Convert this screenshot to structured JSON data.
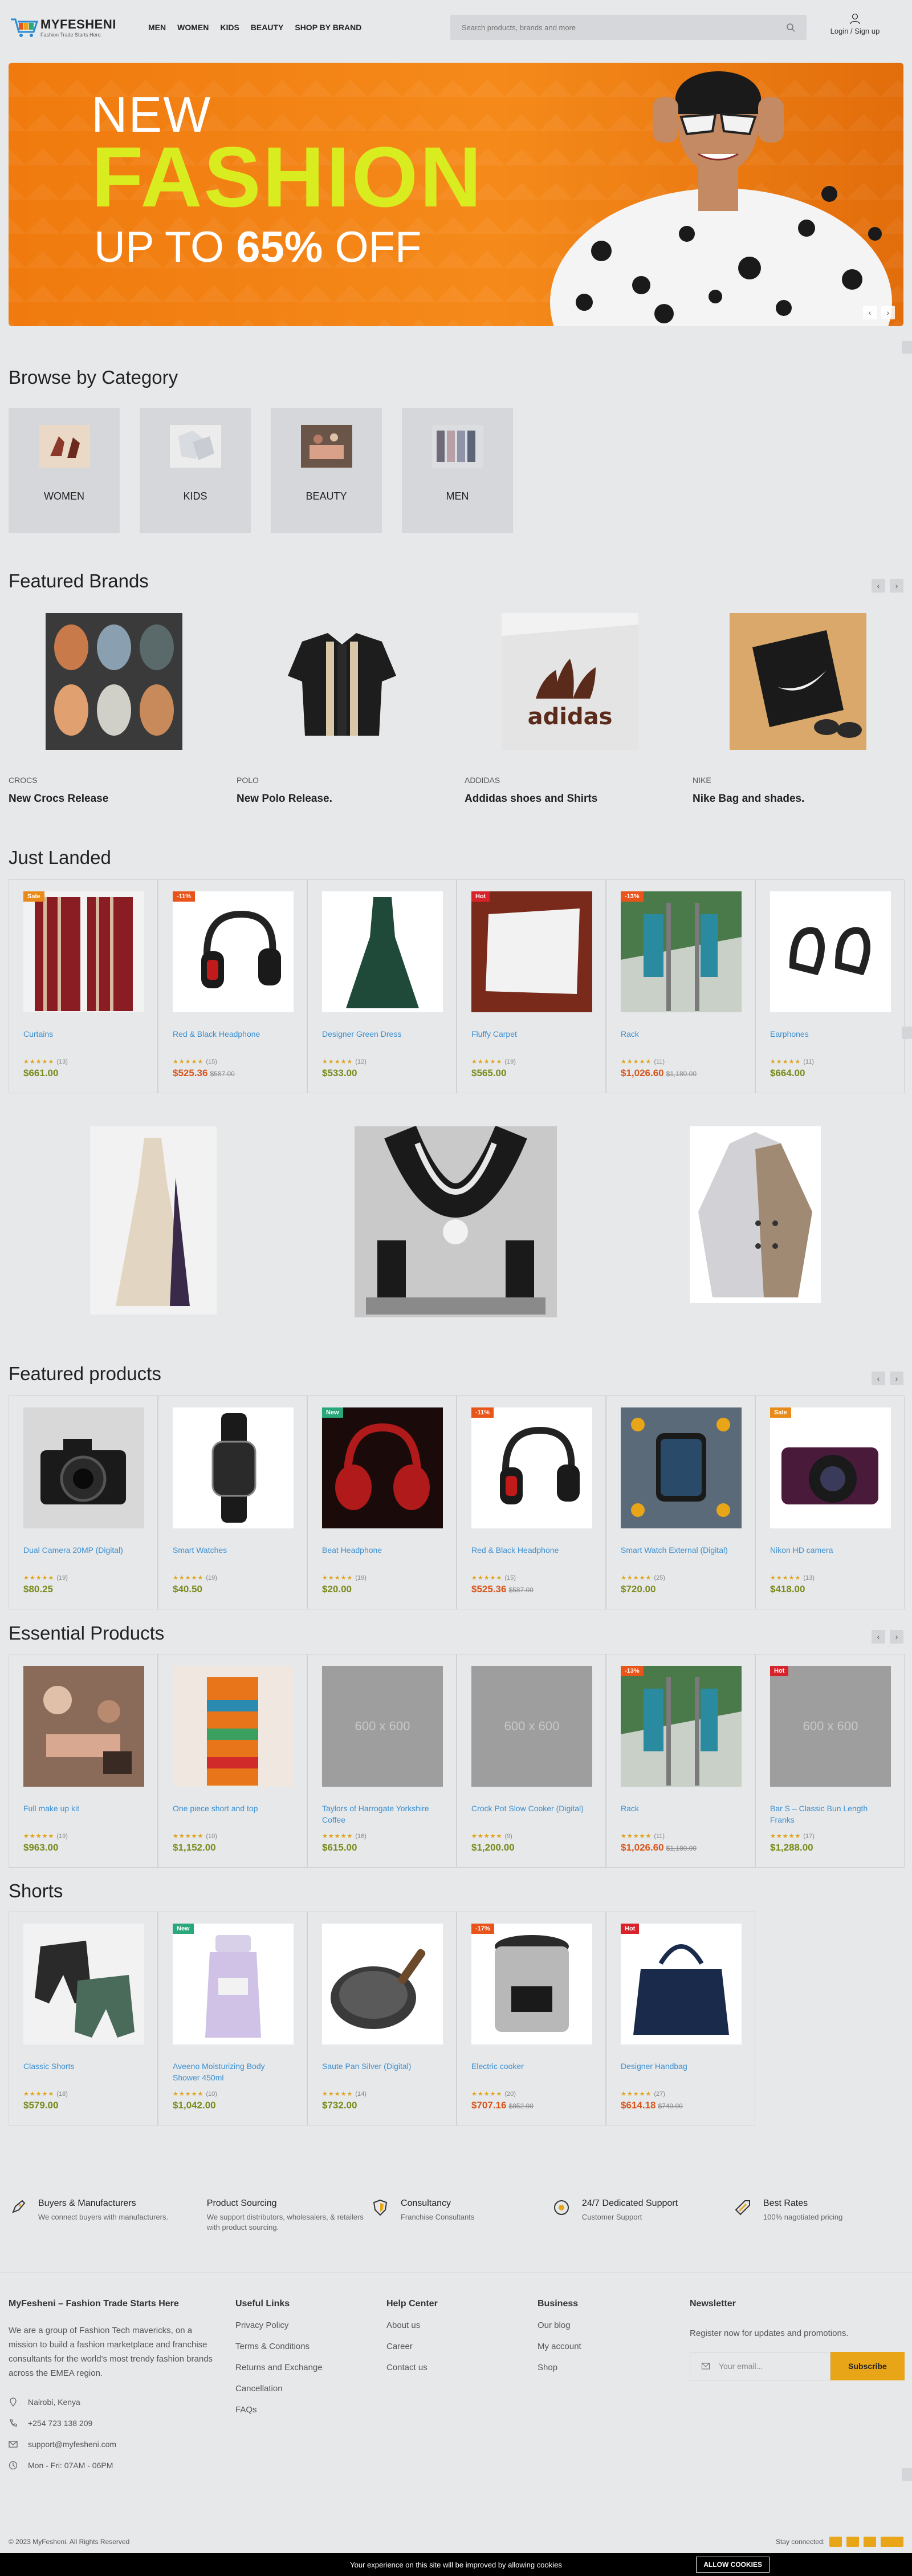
{
  "header": {
    "logo_name": "MYFESHENI",
    "logo_tagline": "Fashion Trade Starts Here.",
    "nav": [
      "MEN",
      "WOMEN",
      "KIDS",
      "BEAUTY",
      "SHOP BY BRAND"
    ],
    "search_placeholder": "Search products, brands and more",
    "account_label": "Login / Sign up"
  },
  "hero": {
    "line1": "NEW",
    "line2": "FASHION",
    "line3_prefix": "UP TO ",
    "line3_bold": "65%",
    "line3_suffix": " OFF",
    "colors": {
      "orange": "#f07a0e",
      "lime": "#d8ec1f"
    }
  },
  "categories": {
    "title": "Browse by Category",
    "items": [
      "WOMEN",
      "KIDS",
      "BEAUTY",
      "MEN"
    ]
  },
  "brands": {
    "title": "Featured Brands",
    "items": [
      {
        "brand": "CROCS",
        "title": "New Crocs Release"
      },
      {
        "brand": "POLO",
        "title": "New Polo Release."
      },
      {
        "brand": "ADDIDAS",
        "title": "Addidas shoes and Shirts"
      },
      {
        "brand": "NIKE",
        "title": "Nike Bag and shades."
      }
    ]
  },
  "just_landed": {
    "title": "Just Landed",
    "products": [
      {
        "name": "Curtains",
        "badge": "Sale",
        "rating_count": "(13)",
        "price": "$661.00",
        "old_price": ""
      },
      {
        "name": "Red & Black Headphone",
        "badge": "-11%",
        "rating_count": "(15)",
        "price": "$525.36",
        "old_price": "$587.00"
      },
      {
        "name": "Designer Green Dress",
        "badge": "",
        "rating_count": "(12)",
        "price": "$533.00",
        "old_price": ""
      },
      {
        "name": "Fluffy Carpet",
        "badge": "Hot",
        "rating_count": "(19)",
        "price": "$565.00",
        "old_price": ""
      },
      {
        "name": "Rack",
        "badge": "-13%",
        "rating_count": "(11)",
        "price": "$1,026.60",
        "old_price": "$1,180.00"
      },
      {
        "name": "Earphones",
        "badge": "",
        "rating_count": "(11)",
        "price": "$664.00",
        "old_price": ""
      }
    ]
  },
  "featured_products": {
    "title": "Featured products",
    "products": [
      {
        "name": "Dual Camera 20MP (Digital)",
        "badge": "",
        "rating_count": "(19)",
        "price": "$80.25",
        "old_price": ""
      },
      {
        "name": "Smart Watches",
        "badge": "",
        "rating_count": "(19)",
        "price": "$40.50",
        "old_price": ""
      },
      {
        "name": "Beat Headphone",
        "badge": "New",
        "rating_count": "(19)",
        "price": "$20.00",
        "old_price": ""
      },
      {
        "name": "Red & Black Headphone",
        "badge": "-11%",
        "rating_count": "(15)",
        "price": "$525.36",
        "old_price": "$587.00"
      },
      {
        "name": "Smart Watch External (Digital)",
        "badge": "",
        "rating_count": "(25)",
        "price": "$720.00",
        "old_price": ""
      },
      {
        "name": "Nikon HD camera",
        "badge": "Sale",
        "rating_count": "(13)",
        "price": "$418.00",
        "old_price": ""
      }
    ]
  },
  "essential_products": {
    "title": "Essential Products",
    "products": [
      {
        "name": "Full make up kit",
        "badge": "",
        "rating_count": "(19)",
        "price": "$963.00",
        "old_price": ""
      },
      {
        "name": "One piece short and top",
        "badge": "",
        "rating_count": "(10)",
        "price": "$1,152.00",
        "old_price": ""
      },
      {
        "name": "Taylors of Harrogate Yorkshire Coffee",
        "badge": "",
        "rating_count": "(16)",
        "price": "$615.00",
        "old_price": ""
      },
      {
        "name": "Crock Pot Slow Cooker (Digital)",
        "badge": "",
        "rating_count": "(9)",
        "price": "$1,200.00",
        "old_price": ""
      },
      {
        "name": "Rack",
        "badge": "-13%",
        "rating_count": "(11)",
        "price": "$1,026.60",
        "old_price": "$1,180.00"
      },
      {
        "name": "Bar S – Classic Bun Length Franks",
        "badge": "Hot",
        "rating_count": "(17)",
        "price": "$1,288.00",
        "old_price": ""
      }
    ],
    "placeholder_text": "600 x 600"
  },
  "shorts": {
    "title": "Shorts",
    "products": [
      {
        "name": "Classic Shorts",
        "badge": "",
        "rating_count": "(18)",
        "price": "$579.00",
        "old_price": ""
      },
      {
        "name": "Aveeno Moisturizing Body Shower 450ml",
        "badge": "New",
        "rating_count": "(10)",
        "price": "$1,042.00",
        "old_price": ""
      },
      {
        "name": "Saute Pan Silver (Digital)",
        "badge": "",
        "rating_count": "(14)",
        "price": "$732.00",
        "old_price": ""
      },
      {
        "name": "Electric cooker",
        "badge": "-17%",
        "rating_count": "(20)",
        "price": "$707.16",
        "old_price": "$852.00"
      },
      {
        "name": "Designer Handbag",
        "badge": "Hot",
        "rating_count": "(27)",
        "price": "$614.18",
        "old_price": "$749.00"
      }
    ]
  },
  "features": [
    {
      "title": "Buyers & Manufacturers",
      "sub": "We connect buyers with manufacturers."
    },
    {
      "title": "Product Sourcing",
      "sub": "We support distributors, wholesalers, & retailers with product sourcing."
    },
    {
      "title": "Consultancy",
      "sub": "Franchise Consultants"
    },
    {
      "title": "24/7 Dedicated Support",
      "sub": "Customer Support"
    },
    {
      "title": "Best Rates",
      "sub": "100% nagotiated pricing"
    }
  ],
  "footer": {
    "about_title": "MyFesheni – Fashion Trade Starts Here",
    "about_text": "We are a group of Fashion Tech mavericks, on a mission to build a fashion marketplace and franchise consultants for the world's most trendy fashion brands across the EMEA region.",
    "location": "Nairobi, Kenya",
    "phone": "+254 723 138 209",
    "email": "support@myfesheni.com",
    "hours": "Mon - Fri: 07AM - 06PM",
    "useful_title": "Useful Links",
    "useful_links": [
      "Privacy Policy",
      "Terms & Conditions",
      "Returns and Exchange",
      "Cancellation",
      "FAQs"
    ],
    "help_title": "Help Center",
    "help_links": [
      "About us",
      "Career",
      "Contact us"
    ],
    "business_title": "Business",
    "business_links": [
      "Our blog",
      "My account",
      "Shop"
    ],
    "newsletter_title": "Newsletter",
    "newsletter_text": "Register now for updates and promotions.",
    "newsletter_placeholder": "Your email...",
    "subscribe_label": "Subscribe",
    "copyright": "© 2023 MyFesheni. All Rights Reserved",
    "stay_connected": "Stay connected:"
  },
  "cookie": {
    "text": "Your experience on this site will be improved by allowing cookies",
    "button": "ALLOW COOKIES"
  }
}
